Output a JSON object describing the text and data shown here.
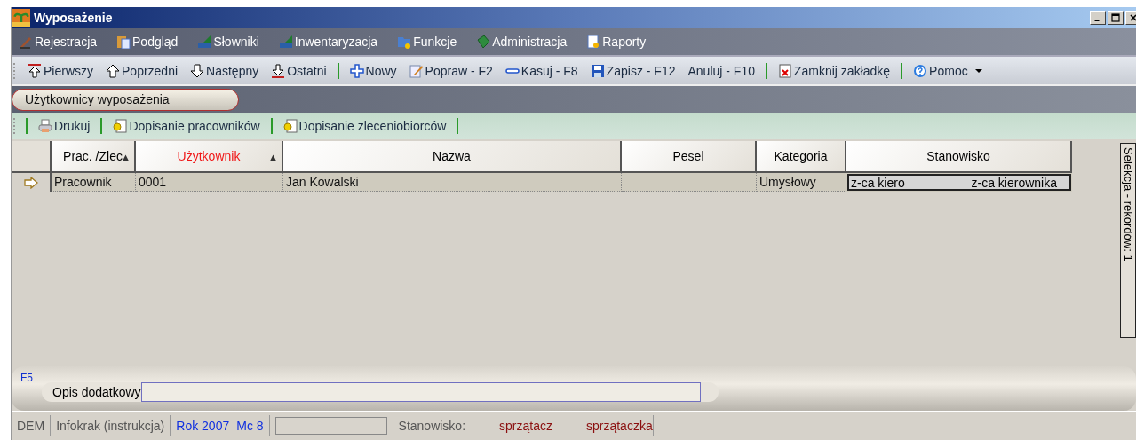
{
  "window": {
    "title": "Wyposażenie"
  },
  "menu": [
    {
      "label": "Rejestracja"
    },
    {
      "label": "Podgląd"
    },
    {
      "label": "Słowniki"
    },
    {
      "label": "Inwentaryzacja"
    },
    {
      "label": "Funkcje"
    },
    {
      "label": "Administracja"
    },
    {
      "label": "Raporty"
    }
  ],
  "toolbar": [
    {
      "kind": "button",
      "label": "Pierwszy"
    },
    {
      "kind": "button",
      "label": "Poprzedni"
    },
    {
      "kind": "button",
      "label": "Następny"
    },
    {
      "kind": "button",
      "label": "Ostatni"
    },
    {
      "kind": "separator"
    },
    {
      "kind": "button",
      "label": "Nowy"
    },
    {
      "kind": "button",
      "label": "Popraw - F2"
    },
    {
      "kind": "button",
      "label": "Kasuj - F8"
    },
    {
      "kind": "button",
      "label": "Zapisz - F12"
    },
    {
      "kind": "button",
      "label": "Anuluj - F10"
    },
    {
      "kind": "separator"
    },
    {
      "kind": "button",
      "label": "Zamknij zakładkę"
    },
    {
      "kind": "separator"
    },
    {
      "kind": "dropdown",
      "label": "Pomoc"
    }
  ],
  "tabs": [
    {
      "label": "Użytkownicy wyposażenia",
      "selected": true
    }
  ],
  "subtoolbar": [
    {
      "kind": "separator"
    },
    {
      "kind": "button",
      "label": "Drukuj"
    },
    {
      "kind": "separator"
    },
    {
      "kind": "button",
      "label": "Dopisanie pracowników"
    },
    {
      "kind": "separator"
    },
    {
      "kind": "button",
      "label": "Dopisanie zleceniobiorców"
    },
    {
      "kind": "separator"
    }
  ],
  "table": {
    "columns": [
      {
        "label": "Prac. /Zlec",
        "sorted": true,
        "highlighted": false
      },
      {
        "label": "Użytkownik",
        "sorted": true,
        "highlighted": true
      },
      {
        "label": "Nazwa",
        "sorted": false,
        "highlighted": false
      },
      {
        "label": "Pesel",
        "sorted": false,
        "highlighted": false
      },
      {
        "label": "Kategoria",
        "sorted": false,
        "highlighted": false
      },
      {
        "label": "Stanowisko",
        "sorted": false,
        "highlighted": false
      }
    ],
    "rows": [
      {
        "current": true,
        "cells": [
          "Pracownik",
          "0001",
          "Jan Kowalski",
          "",
          "Umysłowy"
        ],
        "position": {
          "code": "z-ca kiero",
          "name": "z-ca kierownika"
        }
      }
    ]
  },
  "side_tab": {
    "label": "Selekcja - rekordów: 1"
  },
  "details": {
    "shortcut": "F5",
    "label": "Opis dodatkowy"
  },
  "status_bar": {
    "company": "DEM",
    "database": "Infokrak (instrukcja)",
    "year": "Rok 2007",
    "month": "Mc 8",
    "position_label": "Stanowisko:",
    "position_code": "sprzątacz",
    "position_name": "sprzątaczka"
  }
}
